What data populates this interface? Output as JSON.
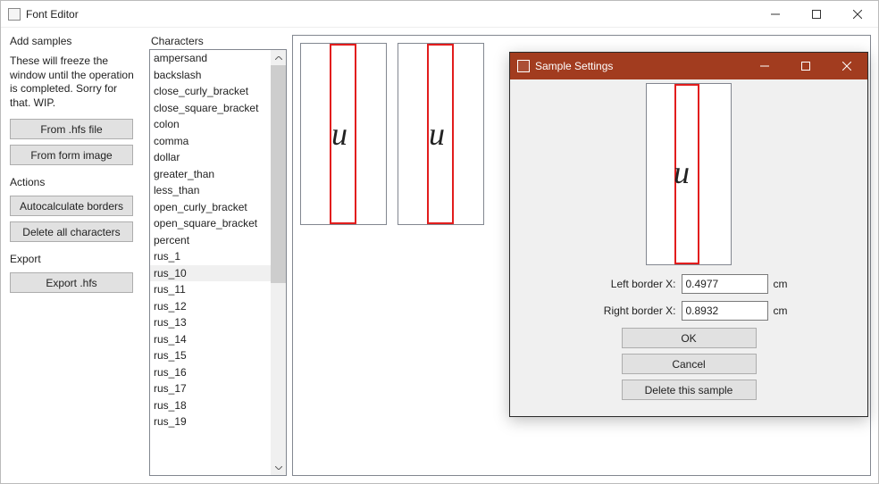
{
  "window": {
    "title": "Font Editor"
  },
  "sidebar": {
    "add_samples_heading": "Add samples",
    "add_samples_desc": "These will freeze the window until the operation is completed. Sorry for that. WIP.",
    "from_hfs_label": "From .hfs file",
    "from_form_image_label": "From form image",
    "actions_heading": "Actions",
    "autocalc_label": "Autocalculate borders",
    "delete_all_label": "Delete all characters",
    "export_heading": "Export",
    "export_hfs_label": "Export .hfs"
  },
  "characters": {
    "heading": "Characters",
    "items": [
      "ampersand",
      "backslash",
      "close_curly_bracket",
      "close_square_bracket",
      "colon",
      "comma",
      "dollar",
      "greater_than",
      "less_than",
      "open_curly_bracket",
      "open_square_bracket",
      "percent",
      "rus_1",
      "rus_10",
      "rus_11",
      "rus_12",
      "rus_13",
      "rus_14",
      "rus_15",
      "rus_16",
      "rus_17",
      "rus_18",
      "rus_19"
    ],
    "selected_index": 13
  },
  "samples": [
    {
      "glyph": "и"
    },
    {
      "glyph": "и"
    }
  ],
  "modal": {
    "title": "Sample Settings",
    "preview_glyph": "и",
    "left_label": "Left border X:",
    "left_value": "0.4977",
    "right_label": "Right border X:",
    "right_value": "0.8932",
    "unit": "cm",
    "ok_label": "OK",
    "cancel_label": "Cancel",
    "delete_label": "Delete this sample"
  }
}
